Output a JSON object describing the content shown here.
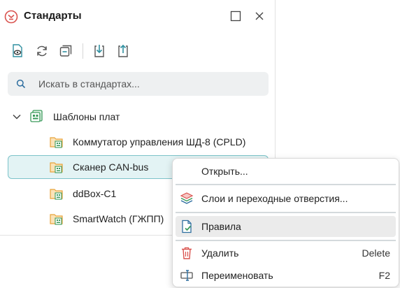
{
  "panel": {
    "title": "Стандарты",
    "app_icon": "standards-logo-icon",
    "window_buttons": [
      "maximize-icon",
      "close-icon"
    ]
  },
  "toolbar": {
    "tools": [
      "view-document-icon",
      "refresh-icon",
      "collapse-all-icon",
      "import-icon",
      "export-icon"
    ]
  },
  "search": {
    "placeholder": "Искать в стандартах..."
  },
  "tree": {
    "group": {
      "label": "Шаблоны плат",
      "expanded": true
    },
    "items": [
      {
        "label": "Коммутатор управления ШД-8 (CPLD)"
      },
      {
        "label": "Сканер CAN-bus",
        "selected": true
      },
      {
        "label": "ddBox-C1"
      },
      {
        "label": "SmartWatch (ГЖПП)"
      }
    ]
  },
  "context_menu": {
    "items": [
      {
        "label": "Открыть...",
        "icon": "",
        "shortcut": ""
      },
      {
        "label": "Слои и переходные отверстия...",
        "icon": "layers-icon",
        "shortcut": ""
      },
      {
        "label": "Правила",
        "icon": "rules-document-icon",
        "shortcut": "",
        "highlighted": true
      },
      {
        "label": "Удалить",
        "icon": "trash-icon",
        "shortcut": "Delete"
      },
      {
        "label": "Переименовать",
        "icon": "rename-icon",
        "shortcut": "F2"
      }
    ]
  },
  "colors": {
    "accent": "#2f8fa0",
    "selection_bg": "#e3f3f4",
    "selection_border": "#7cc3c9",
    "delete_red": "#d9534f",
    "folder_orange": "#e8a33a"
  }
}
